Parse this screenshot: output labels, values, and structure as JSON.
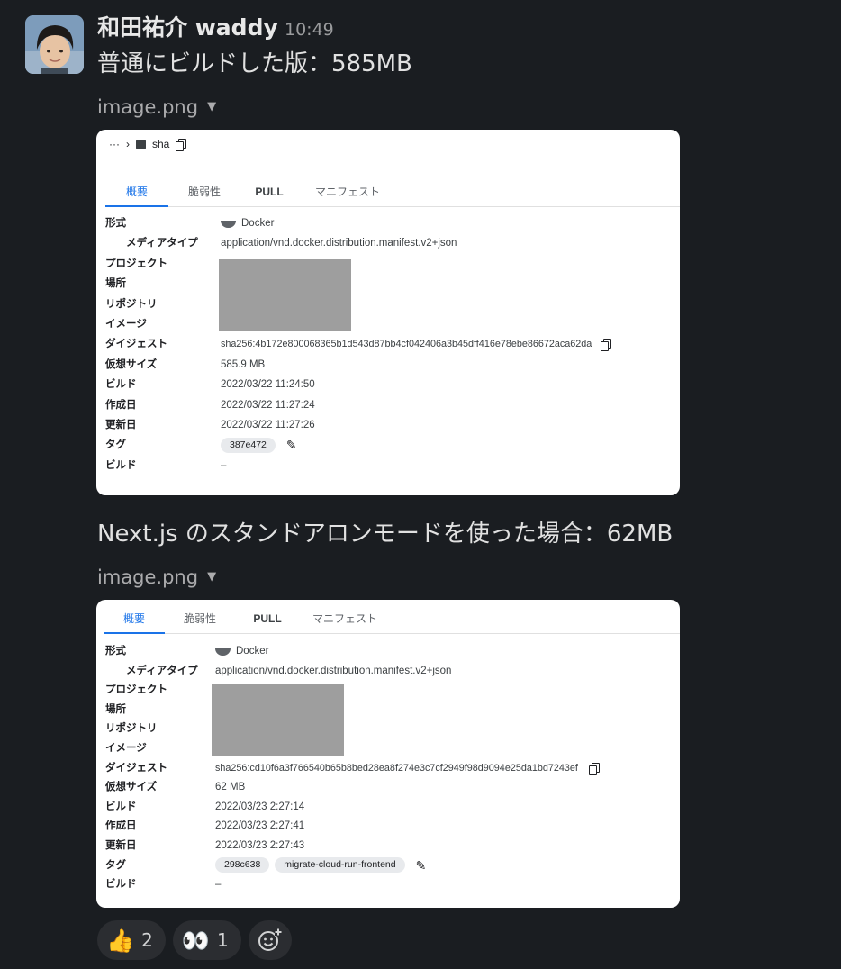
{
  "message": {
    "author": "和田祐介 waddy",
    "time": "10:49",
    "text1": "普通にビルドした版：585MB",
    "text2": "Next.js のスタンドアロンモードを使った場合：62MB"
  },
  "attachments": [
    {
      "filename": "image.png",
      "breadcrumb": {
        "ellipsis": "···",
        "separator": "›",
        "name": "sha"
      },
      "tabs": [
        "概要",
        "脆弱性",
        "PULL",
        "マニフェスト"
      ],
      "labels": {
        "type": "形式",
        "media_type": "メディアタイプ",
        "project": "プロジェクト",
        "location": "場所",
        "repository": "リポジトリ",
        "image": "イメージ",
        "digest": "ダイジェスト",
        "virtual_size": "仮想サイズ",
        "build": "ビルド",
        "created": "作成日",
        "updated": "更新日",
        "tag": "タグ",
        "build2": "ビルド"
      },
      "values": {
        "type": "Docker",
        "media_type": "application/vnd.docker.distribution.manifest.v2+json",
        "digest": "sha256:4b172e800068365b1d543d87bb4cf042406a3b45dff416e78ebe86672aca62da",
        "virtual_size": "585.9 MB",
        "build": "2022/03/22 11:24:50",
        "created": "2022/03/22 11:27:24",
        "updated": "2022/03/22 11:27:26",
        "tags": [
          "387e472"
        ],
        "build2": "–"
      }
    },
    {
      "filename": "image.png",
      "tabs": [
        "概要",
        "脆弱性",
        "PULL",
        "マニフェスト"
      ],
      "labels": {
        "type": "形式",
        "media_type": "メディアタイプ",
        "project": "プロジェクト",
        "location": "場所",
        "repository": "リポジトリ",
        "image": "イメージ",
        "digest": "ダイジェスト",
        "virtual_size": "仮想サイズ",
        "build": "ビルド",
        "created": "作成日",
        "updated": "更新日",
        "tag": "タグ",
        "build2": "ビルド"
      },
      "values": {
        "type": "Docker",
        "media_type": "application/vnd.docker.distribution.manifest.v2+json",
        "digest": "sha256:cd10f6a3f766540b65b8bed28ea8f274e3c7cf2949f98d9094e25da1bd7243ef",
        "virtual_size": "62 MB",
        "build": "2022/03/23 2:27:14",
        "created": "2022/03/23 2:27:41",
        "updated": "2022/03/23 2:27:43",
        "tags": [
          "298c638",
          "migrate-cloud-run-frontend"
        ],
        "build2": "–"
      }
    }
  ],
  "reactions": [
    {
      "emoji": "👍",
      "count": "2"
    },
    {
      "emoji": "👀",
      "count": "1"
    }
  ],
  "icons": {
    "copy": "copy-icon",
    "edit": "pencil-icon",
    "docker": "docker-icon",
    "add_reaction": "add-reaction-icon",
    "dropdown": "caret-down-icon"
  }
}
